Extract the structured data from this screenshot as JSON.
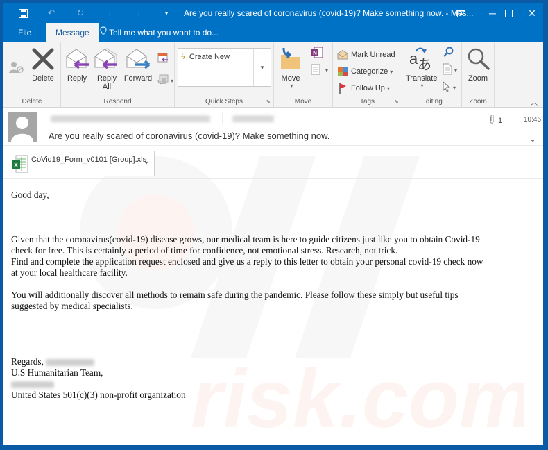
{
  "window": {
    "title": "Are you really scared of coronavirus (covid-19)? Make something now. - Mes...",
    "quick_access": [
      "save-icon",
      "undo-icon",
      "redo-icon",
      "previous-item-icon",
      "next-item-icon",
      "customize-qat-icon"
    ],
    "controls": [
      "ribbon-display-options-icon",
      "minimize-icon",
      "maximize-icon",
      "close-icon"
    ]
  },
  "tabs": {
    "file": "File",
    "message": "Message",
    "tell_me": "Tell me what you want to do..."
  },
  "ribbon": {
    "delete_group": {
      "label": "Delete",
      "delete": "Delete"
    },
    "respond_group": {
      "label": "Respond",
      "reply": "Reply",
      "reply_all_1": "Reply",
      "reply_all_2": "All",
      "forward": "Forward"
    },
    "quicksteps_group": {
      "label": "Quick Steps",
      "create_new": "Create New"
    },
    "move_group": {
      "label": "Move",
      "move": "Move"
    },
    "tags_group": {
      "label": "Tags",
      "mark_unread": "Mark Unread",
      "categorize": "Categorize",
      "follow_up": "Follow Up"
    },
    "editing_group": {
      "label": "Editing",
      "translate": "Translate"
    },
    "zoom_group": {
      "label": "Zoom",
      "zoom": "Zoom"
    }
  },
  "message": {
    "subject": "Are you really scared of coronavirus (covid-19)? Make something now.",
    "attachment_count": "1",
    "time": "10:46",
    "attachment": {
      "filename": "CoVid19_Form_v0101 [Group].xls"
    },
    "body": {
      "greeting": "Good day,",
      "p1_l1": "Given that the coronavirus(covid-19) disease grows, our medical team is here to guide citizens just like you to obtain Covid-19",
      "p1_l2": "check for free. This is certainly a period of time for confidence, not emotional stress. Research, not trick.",
      "p1_l3": "Find and complete the application request enclosed and give us a reply to this letter to obtain your personal covid-19 check now",
      "p1_l4": "at your local healthcare facility.",
      "p2_l1": "You will additionally discover all methods to remain safe during the pandemic. Please follow these simply but useful tips",
      "p2_l2": "suggested by medical specialists.",
      "regards": "Regards,",
      "team": "U.S Humanitarian Team,",
      "org": "United States 501(c)(3) non-profit organization"
    }
  },
  "colors": {
    "accent": "#0072c6",
    "frame": "#0b5aa6"
  }
}
